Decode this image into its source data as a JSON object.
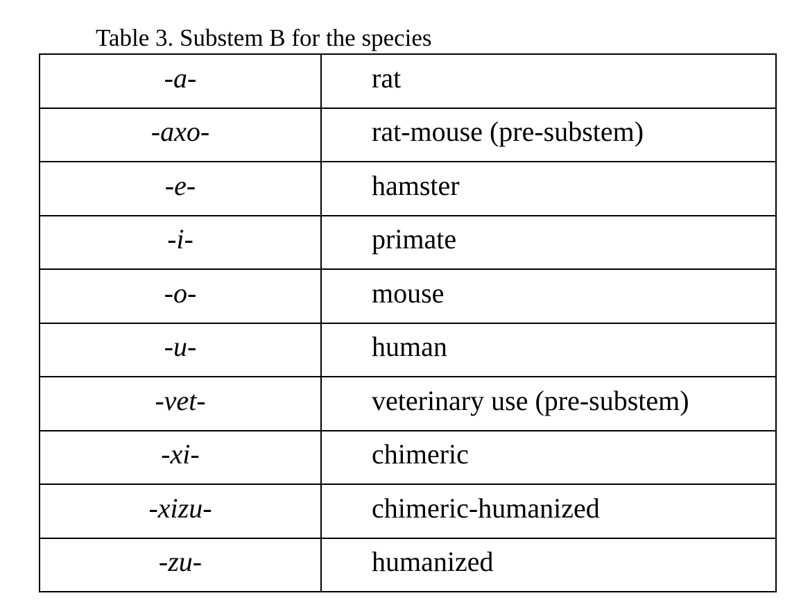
{
  "caption": "Table 3. Substem B for the species",
  "rows": [
    {
      "stem": "-a-",
      "meaning": "rat"
    },
    {
      "stem": "-axo-",
      "meaning": "rat-mouse (pre-substem)"
    },
    {
      "stem": "-e-",
      "meaning": "hamster"
    },
    {
      "stem": "-i-",
      "meaning": "primate"
    },
    {
      "stem": "-o-",
      "meaning": "mouse"
    },
    {
      "stem": "-u-",
      "meaning": "human"
    },
    {
      "stem": "-vet-",
      "meaning": "veterinary use (pre-substem)"
    },
    {
      "stem": "-xi-",
      "meaning": "chimeric"
    },
    {
      "stem": "-xizu-",
      "meaning": "chimeric-humanized"
    },
    {
      "stem": "-zu-",
      "meaning": "humanized"
    }
  ]
}
